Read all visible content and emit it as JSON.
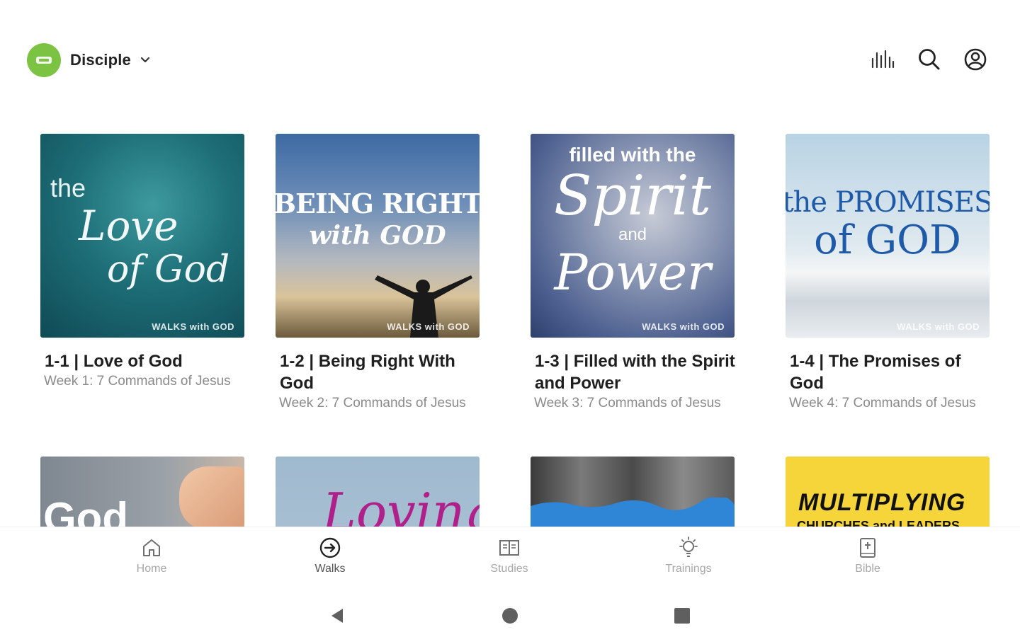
{
  "header": {
    "org_name": "Disciple",
    "logo_icon": "organization-logo",
    "actions": [
      "stats-icon",
      "search-icon",
      "account-icon"
    ]
  },
  "cards": [
    {
      "title": "1-1 | Love of God",
      "subtitle": "Week 1: 7 Commands of Jesus",
      "art_lines": [
        "the",
        "Love",
        "of God"
      ],
      "watermark": "WALKS with GOD"
    },
    {
      "title": "1-2 | Being Right With God",
      "subtitle": "Week 2: 7 Commands of Jesus",
      "art_lines": [
        "BEING RIGHT",
        "with GOD"
      ],
      "watermark": "WALKS with GOD"
    },
    {
      "title": "1-3 | Filled with the Spirit and Power",
      "subtitle": "Week 3: 7 Commands of Jesus",
      "art_lines": [
        "filled with the",
        "Spirit",
        "and",
        "Power"
      ],
      "watermark": "WALKS with GOD"
    },
    {
      "title": "1-4 | The Promises of God",
      "subtitle": "Week 4: 7 Commands of Jesus",
      "art_lines": [
        "the PROMISES",
        "of GOD"
      ],
      "watermark": "WALKS with GOD"
    },
    {
      "art_lines": [
        "God"
      ]
    },
    {
      "art_lines": [
        "Loving"
      ]
    },
    {
      "art_lines": []
    },
    {
      "art_lines": [
        "MULTIPLYING",
        "CHURCHES and LEADERS"
      ]
    }
  ],
  "bottom_nav": {
    "active": "Walks",
    "items": [
      {
        "label": "Home",
        "icon": "home-icon"
      },
      {
        "label": "Walks",
        "icon": "arrow-circle-icon"
      },
      {
        "label": "Studies",
        "icon": "book-open-icon"
      },
      {
        "label": "Trainings",
        "icon": "lightbulb-icon"
      },
      {
        "label": "Bible",
        "icon": "bible-icon"
      }
    ]
  },
  "system_nav": [
    "back-icon",
    "home-circle-icon",
    "recents-icon"
  ]
}
